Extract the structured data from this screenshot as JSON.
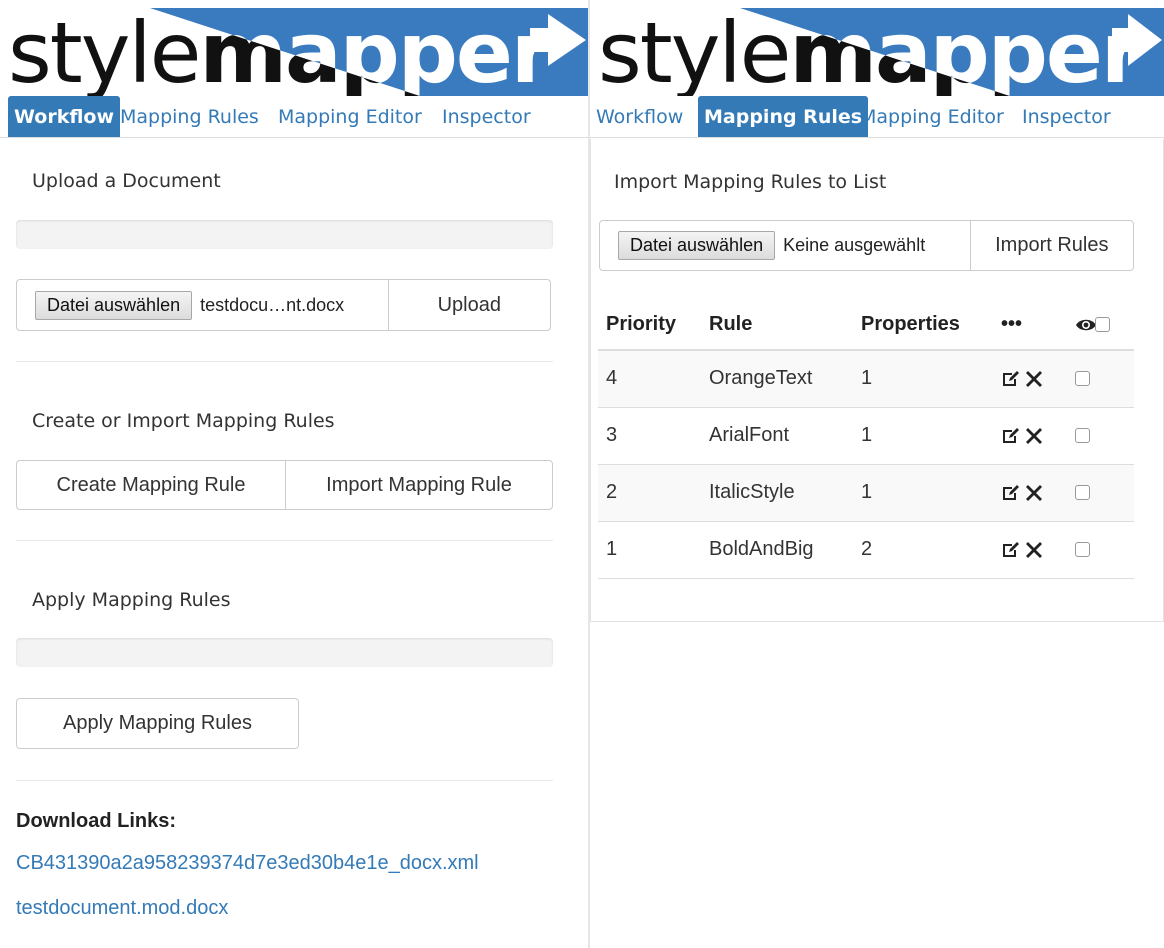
{
  "logo": {
    "text_light": "style",
    "text_dark": "mapper"
  },
  "left": {
    "tabs": [
      {
        "label": "Workflow",
        "active": true
      },
      {
        "label": "Mapping Rules",
        "active": false
      },
      {
        "label": "Mapping Editor",
        "active": false
      },
      {
        "label": "Inspector",
        "active": false
      }
    ],
    "upload": {
      "title": "Upload a Document",
      "file_button": "Datei auswählen",
      "file_name": "testdocu…nt.docx",
      "upload_button": "Upload"
    },
    "create": {
      "title": "Create or Import Mapping Rules",
      "create_button": "Create Mapping Rule",
      "import_button": "Import Mapping Rule"
    },
    "apply": {
      "title": "Apply Mapping Rules",
      "apply_button": "Apply Mapping Rules"
    },
    "downloads": {
      "label": "Download Links:",
      "links": [
        "CB431390a2a958239374d7e3ed30b4e1e_docx.xml",
        "testdocument.mod.docx"
      ]
    }
  },
  "right": {
    "tabs": [
      {
        "label": "Workflow",
        "active": false
      },
      {
        "label": "Mapping Rules",
        "active": true
      },
      {
        "label": "Mapping Editor",
        "active": false
      },
      {
        "label": "Inspector",
        "active": false
      }
    ],
    "import": {
      "title": "Import Mapping Rules to List",
      "file_button": "Datei auswählen",
      "file_status": "Keine ausgewählt",
      "import_button": "Import Rules"
    },
    "table": {
      "headers": [
        "Priority",
        "Rule",
        "Properties",
        "•••"
      ],
      "rows": [
        {
          "priority": "4",
          "rule": "OrangeText",
          "properties": "1"
        },
        {
          "priority": "3",
          "rule": "ArialFont",
          "properties": "1"
        },
        {
          "priority": "2",
          "rule": "ItalicStyle",
          "properties": "1"
        },
        {
          "priority": "1",
          "rule": "BoldAndBig",
          "properties": "2"
        }
      ]
    }
  },
  "colors": {
    "brand_blue": "#337ab7",
    "logo_blue": "#3a7bbf"
  },
  "icons": [
    "edit-icon",
    "delete-icon",
    "eye-icon",
    "arrow-icon"
  ]
}
